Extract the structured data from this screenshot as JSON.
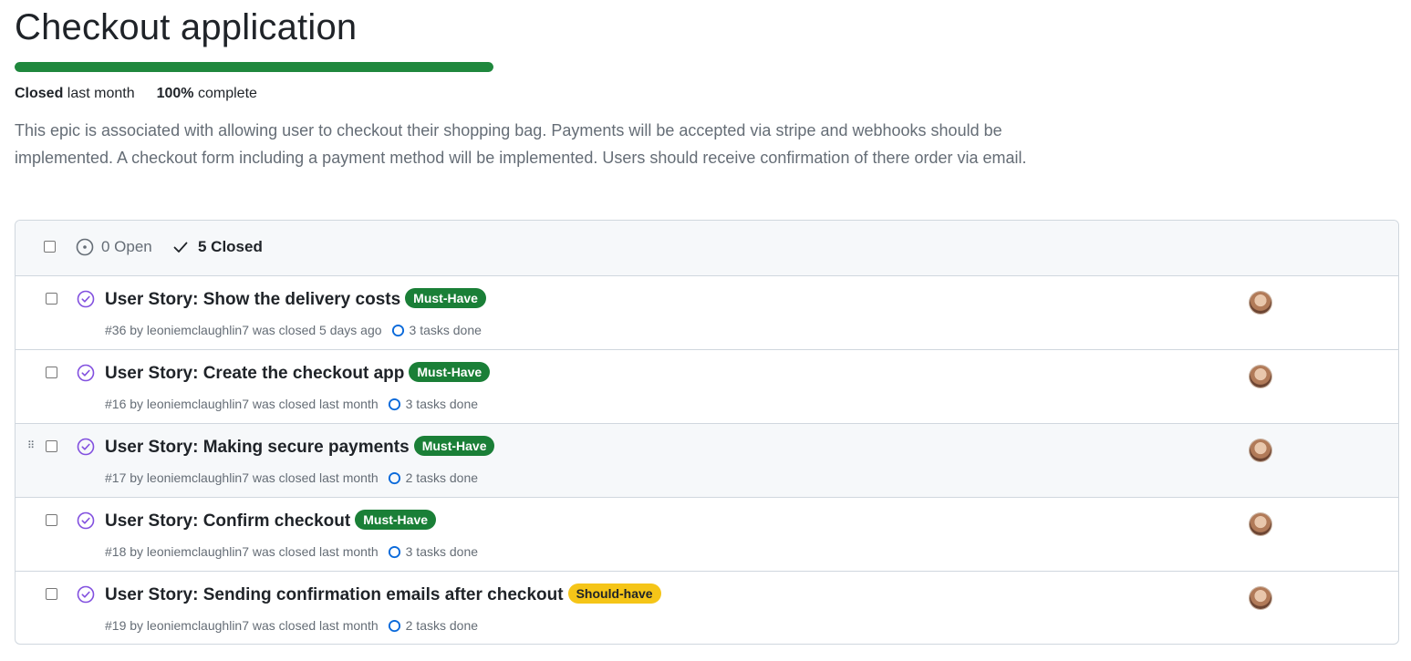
{
  "milestone": {
    "title": "Checkout application",
    "progress_fraction": 1.0,
    "closed_label": "Closed",
    "closed_when": "last month",
    "percent": "100%",
    "complete_label": "complete",
    "description": "This epic is associated with allowing user to checkout their shopping bag. Payments will be accepted via stripe and webhooks should be implemented. A checkout form including a payment method will be implemented. Users should receive confirmation of there order via email."
  },
  "filters": {
    "open": "0 Open",
    "closed": "5 Closed"
  },
  "colors": {
    "progress": "#1f883d",
    "must_have": "#1a7f37",
    "should_have": "#f5c518",
    "closed_icon": "#8250df",
    "task_ring": "#0969da"
  },
  "issues": [
    {
      "title": "User Story: Show the delivery costs",
      "label": "Must-Have",
      "meta": "#36 by leoniemclaughlin7 was closed 5 days ago",
      "tasks": "3 tasks done"
    },
    {
      "title": "User Story: Create the checkout app",
      "label": "Must-Have",
      "meta": "#16 by leoniemclaughlin7 was closed last month",
      "tasks": "3 tasks done"
    },
    {
      "title": "User Story: Making secure payments",
      "label": "Must-Have",
      "meta": "#17 by leoniemclaughlin7 was closed last month",
      "tasks": "2 tasks done"
    },
    {
      "title": "User Story: Confirm checkout",
      "label": "Must-Have",
      "meta": "#18 by leoniemclaughlin7 was closed last month",
      "tasks": "3 tasks done"
    },
    {
      "title": "User Story: Sending confirmation emails after checkout",
      "label": "Should-have",
      "meta": "#19 by leoniemclaughlin7 was closed last month",
      "tasks": "2 tasks done"
    }
  ]
}
